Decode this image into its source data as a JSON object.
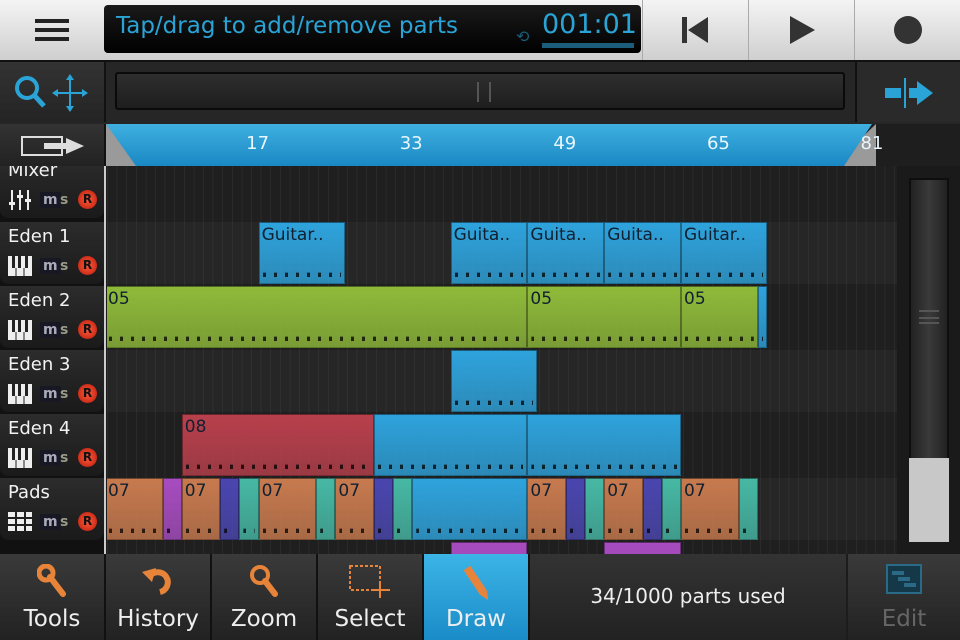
{
  "header": {
    "message": "Tap/drag to add/remove parts",
    "time": "001:01"
  },
  "colors": {
    "accent": "#2aa4d6",
    "guitar": "#2ea3dc",
    "green": "#8fbb3a",
    "red": "#b8404c",
    "orange": "#c87a4e",
    "purple": "#a84cc0",
    "indigo": "#4a46b0",
    "teal": "#46b8a4",
    "record": "#e0301a"
  },
  "ruler": {
    "ticks": [
      {
        "bar": 17,
        "label": "17"
      },
      {
        "bar": 33,
        "label": "33"
      },
      {
        "bar": 49,
        "label": "49"
      },
      {
        "bar": 65,
        "label": "65"
      },
      {
        "bar": 81,
        "label": "81"
      }
    ]
  },
  "tracks": [
    {
      "name": "Mixer",
      "icon": "mixer-sliders-icon",
      "m": "m",
      "s": "s",
      "r": "R"
    },
    {
      "name": "Eden 1",
      "icon": "piano-keys-icon",
      "m": "m",
      "s": "s",
      "r": "R"
    },
    {
      "name": "Eden 2",
      "icon": "piano-keys-icon",
      "m": "m",
      "s": "s",
      "r": "R"
    },
    {
      "name": "Eden 3",
      "icon": "piano-keys-icon",
      "m": "m",
      "s": "s",
      "r": "R"
    },
    {
      "name": "Eden 4",
      "icon": "piano-keys-icon",
      "m": "m",
      "s": "s",
      "r": "R"
    },
    {
      "name": "Pads",
      "icon": "drum-pads-icon",
      "m": "m",
      "s": "s",
      "r": "R"
    }
  ],
  "parts": [
    {
      "track": 1,
      "start": 17,
      "len": 9,
      "color": "guitar",
      "label": "Guitar.."
    },
    {
      "track": 1,
      "start": 37,
      "len": 8,
      "color": "guitar",
      "label": "Guita.."
    },
    {
      "track": 1,
      "start": 45,
      "len": 8,
      "color": "guitar",
      "label": "Guita.."
    },
    {
      "track": 1,
      "start": 53,
      "len": 8,
      "color": "guitar",
      "label": "Guita.."
    },
    {
      "track": 1,
      "start": 61,
      "len": 9,
      "color": "guitar",
      "label": "Guitar.."
    },
    {
      "track": 2,
      "start": 1,
      "len": 44,
      "color": "green",
      "label": "05"
    },
    {
      "track": 2,
      "start": 45,
      "len": 16,
      "color": "green",
      "label": "05"
    },
    {
      "track": 2,
      "start": 61,
      "len": 8,
      "color": "green",
      "label": "05"
    },
    {
      "track": 2,
      "start": 69,
      "len": 1,
      "color": "guitar",
      "label": ""
    },
    {
      "track": 3,
      "start": 37,
      "len": 9,
      "color": "guitar",
      "label": ""
    },
    {
      "track": 4,
      "start": 9,
      "len": 20,
      "color": "red",
      "label": "08"
    },
    {
      "track": 4,
      "start": 29,
      "len": 16,
      "color": "guitar",
      "label": ""
    },
    {
      "track": 4,
      "start": 45,
      "len": 16,
      "color": "guitar",
      "label": ""
    },
    {
      "track": 5,
      "start": 1,
      "len": 6,
      "color": "orange",
      "label": "07"
    },
    {
      "track": 5,
      "start": 7,
      "len": 2,
      "color": "purple",
      "label": ""
    },
    {
      "track": 5,
      "start": 9,
      "len": 4,
      "color": "orange",
      "label": "07"
    },
    {
      "track": 5,
      "start": 13,
      "len": 2,
      "color": "indigo",
      "label": ""
    },
    {
      "track": 5,
      "start": 15,
      "len": 2,
      "color": "teal",
      "label": ""
    },
    {
      "track": 5,
      "start": 17,
      "len": 6,
      "color": "orange",
      "label": "07"
    },
    {
      "track": 5,
      "start": 23,
      "len": 2,
      "color": "teal",
      "label": ""
    },
    {
      "track": 5,
      "start": 25,
      "len": 4,
      "color": "orange",
      "label": "07"
    },
    {
      "track": 5,
      "start": 29,
      "len": 2,
      "color": "indigo",
      "label": ""
    },
    {
      "track": 5,
      "start": 31,
      "len": 2,
      "color": "teal",
      "label": ""
    },
    {
      "track": 5,
      "start": 33,
      "len": 12,
      "color": "guitar",
      "label": ""
    },
    {
      "track": 5,
      "start": 45,
      "len": 4,
      "color": "orange",
      "label": "07"
    },
    {
      "track": 5,
      "start": 49,
      "len": 2,
      "color": "indigo",
      "label": ""
    },
    {
      "track": 5,
      "start": 51,
      "len": 2,
      "color": "teal",
      "label": ""
    },
    {
      "track": 5,
      "start": 53,
      "len": 4,
      "color": "orange",
      "label": "07"
    },
    {
      "track": 5,
      "start": 57,
      "len": 2,
      "color": "indigo",
      "label": ""
    },
    {
      "track": 5,
      "start": 59,
      "len": 2,
      "color": "teal",
      "label": ""
    },
    {
      "track": 5,
      "start": 61,
      "len": 6,
      "color": "orange",
      "label": "07"
    },
    {
      "track": 5,
      "start": 67,
      "len": 2,
      "color": "teal",
      "label": ""
    },
    {
      "track": 6,
      "start": 37,
      "len": 8,
      "color": "purple",
      "label": ""
    },
    {
      "track": 6,
      "start": 53,
      "len": 8,
      "color": "purple",
      "label": ""
    }
  ],
  "toolbar": {
    "tools": "Tools",
    "history": "History",
    "zoom": "Zoom",
    "select": "Select",
    "draw": "Draw",
    "status": "34/1000 parts used",
    "edit": "Edit",
    "active": "Draw"
  }
}
